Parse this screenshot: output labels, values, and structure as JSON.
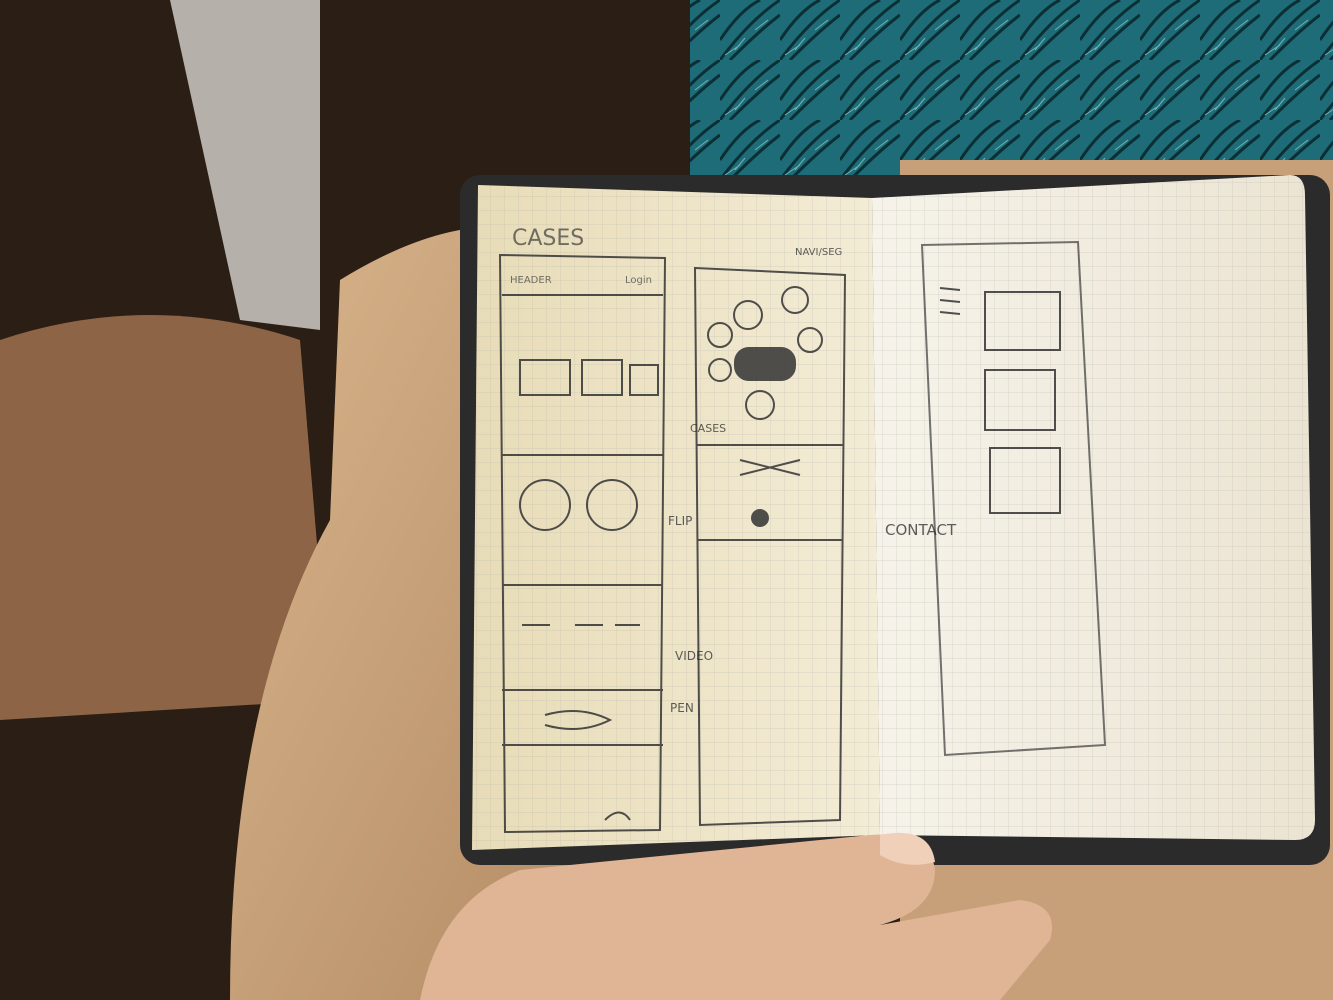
{
  "notebook": {
    "left_page": {
      "heading": "CASES",
      "column1": {
        "header_left": "HEADER",
        "header_right": "Login"
      },
      "callouts": {
        "cases": "CASES",
        "flip": "FLIP",
        "video": "VIDEO",
        "pen": "PEN",
        "nav": "NAVI/SEG",
        "contact": "CONTACT"
      }
    }
  },
  "colors": {
    "paper": "#efe6cc",
    "pencil": "#333333",
    "skin": "#e0b596",
    "leg": "#c9a37c",
    "fabric": "#1f6f78",
    "dark": "#1c140f"
  }
}
